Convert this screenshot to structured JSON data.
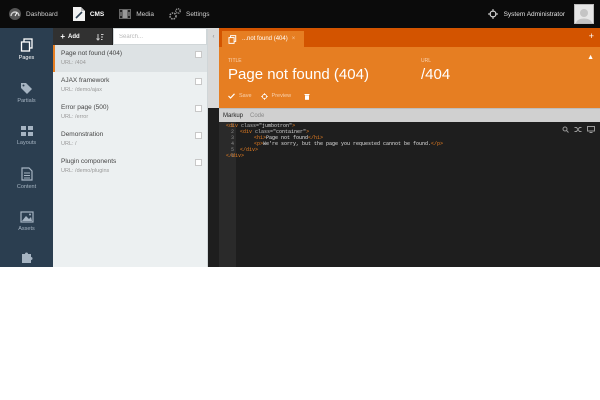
{
  "topbar": {
    "nav": [
      {
        "label": "Dashboard"
      },
      {
        "label": "CMS"
      },
      {
        "label": "Media"
      },
      {
        "label": "Settings"
      }
    ],
    "user_name": "System Administrator"
  },
  "sidebar": {
    "items": [
      {
        "label": "Pages"
      },
      {
        "label": "Partials"
      },
      {
        "label": "Layouts"
      },
      {
        "label": "Content"
      },
      {
        "label": "Assets"
      }
    ]
  },
  "list": {
    "add_label": "Add",
    "search_placeholder": "Search...",
    "items": [
      {
        "title": "Page not found (404)",
        "url": "URL: /404"
      },
      {
        "title": "AJAX framework",
        "url": "URL: /demo/ajax"
      },
      {
        "title": "Error page (500)",
        "url": "URL: /error"
      },
      {
        "title": "Demonstration",
        "url": "URL: /"
      },
      {
        "title": "Plugin components",
        "url": "URL: /demo/plugins"
      }
    ]
  },
  "editor": {
    "tab_label": "...not found (404)",
    "tab_close": "×",
    "tab_add": "+",
    "title_label": "TITLE",
    "title_value": "Page not found (404)",
    "url_label": "URL",
    "url_value": "/404",
    "save_label": "Save",
    "preview_label": "Preview",
    "code_tabs": [
      "Markup",
      "Code"
    ],
    "line_numbers": [
      "1",
      "2",
      "3",
      "4",
      "5",
      "6"
    ]
  },
  "colors": {
    "accent": "#e67e22",
    "accent_dark": "#d35400",
    "sidebar": "#2b3e50",
    "topbar": "#0b0b0b"
  }
}
